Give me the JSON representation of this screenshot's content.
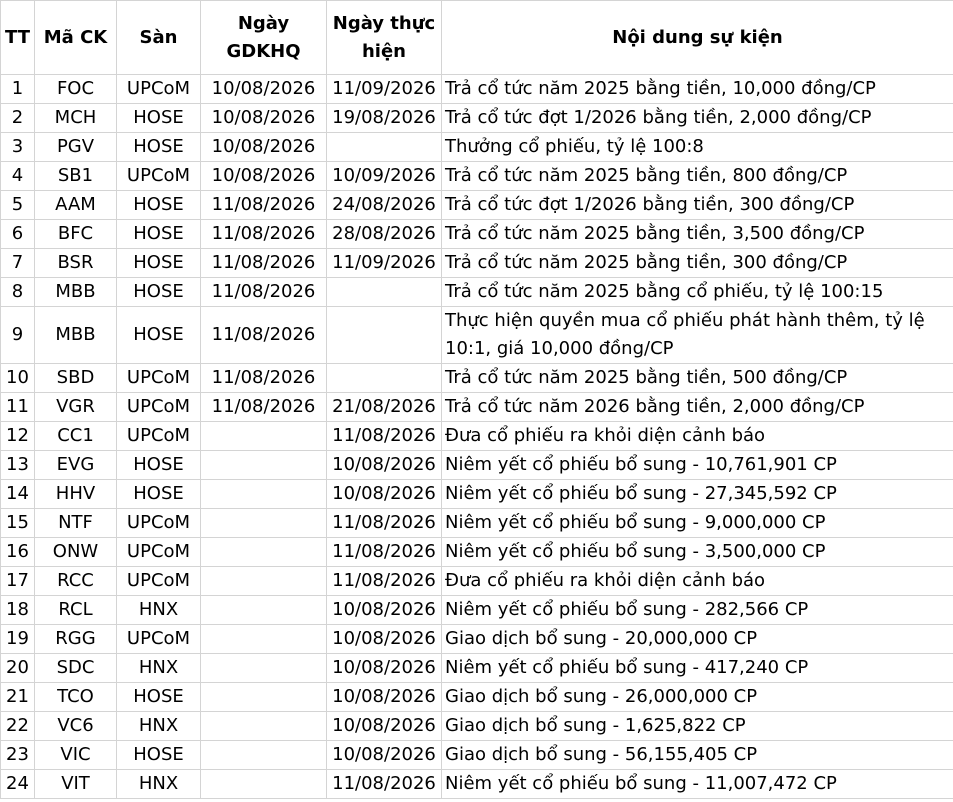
{
  "headers": {
    "tt": "TT",
    "ma_ck": "Mã CK",
    "san": "Sàn",
    "ngay_gdkhq": "Ngày GDKHQ",
    "ngay_thuc_hien": "Ngày thực hiện",
    "noi_dung": "Nội dung sự kiện"
  },
  "rows": [
    {
      "tt": "1",
      "ma": "FOC",
      "san": "UPCoM",
      "gdkhq": "10/08/2026",
      "thuchien": "11/09/2026",
      "noidung": "Trả cổ tức năm 2025 bằng tiền, 10,000 đồng/CP"
    },
    {
      "tt": "2",
      "ma": "MCH",
      "san": "HOSE",
      "gdkhq": "10/08/2026",
      "thuchien": "19/08/2026",
      "noidung": "Trả cổ tức đợt 1/2026 bằng tiền, 2,000 đồng/CP"
    },
    {
      "tt": "3",
      "ma": "PGV",
      "san": "HOSE",
      "gdkhq": "10/08/2026",
      "thuchien": "",
      "noidung": "Thưởng cổ phiếu, tỷ lệ 100:8"
    },
    {
      "tt": "4",
      "ma": "SB1",
      "san": "UPCoM",
      "gdkhq": "10/08/2026",
      "thuchien": "10/09/2026",
      "noidung": "Trả cổ tức năm 2025 bằng tiền, 800 đồng/CP"
    },
    {
      "tt": "5",
      "ma": "AAM",
      "san": "HOSE",
      "gdkhq": "11/08/2026",
      "thuchien": "24/08/2026",
      "noidung": "Trả cổ tức đợt 1/2026 bằng tiền, 300 đồng/CP"
    },
    {
      "tt": "6",
      "ma": "BFC",
      "san": "HOSE",
      "gdkhq": "11/08/2026",
      "thuchien": "28/08/2026",
      "noidung": "Trả cổ tức năm 2025 bằng tiền, 3,500 đồng/CP"
    },
    {
      "tt": "7",
      "ma": "BSR",
      "san": "HOSE",
      "gdkhq": "11/08/2026",
      "thuchien": "11/09/2026",
      "noidung": "Trả cổ tức năm 2025 bằng tiền, 300 đồng/CP"
    },
    {
      "tt": "8",
      "ma": "MBB",
      "san": "HOSE",
      "gdkhq": "11/08/2026",
      "thuchien": "",
      "noidung": "Trả cổ tức năm 2025 bằng cổ phiếu, tỷ lệ 100:15"
    },
    {
      "tt": "9",
      "ma": "MBB",
      "san": "HOSE",
      "gdkhq": "11/08/2026",
      "thuchien": "",
      "noidung": "Thực hiện quyền mua cổ phiếu phát hành thêm, tỷ lệ 10:1, giá 10,000 đồng/CP"
    },
    {
      "tt": "10",
      "ma": "SBD",
      "san": "UPCoM",
      "gdkhq": "11/08/2026",
      "thuchien": "",
      "noidung": "Trả cổ tức năm 2025 bằng tiền, 500 đồng/CP"
    },
    {
      "tt": "11",
      "ma": "VGR",
      "san": "UPCoM",
      "gdkhq": "11/08/2026",
      "thuchien": "21/08/2026",
      "noidung": "Trả cổ tức năm 2026 bằng tiền, 2,000 đồng/CP"
    },
    {
      "tt": "12",
      "ma": "CC1",
      "san": "UPCoM",
      "gdkhq": "",
      "thuchien": "11/08/2026",
      "noidung": "Đưa cổ phiếu ra khỏi diện cảnh báo"
    },
    {
      "tt": "13",
      "ma": "EVG",
      "san": "HOSE",
      "gdkhq": "",
      "thuchien": "10/08/2026",
      "noidung": "Niêm yết cổ phiếu bổ sung - 10,761,901 CP"
    },
    {
      "tt": "14",
      "ma": "HHV",
      "san": "HOSE",
      "gdkhq": "",
      "thuchien": "10/08/2026",
      "noidung": "Niêm yết cổ phiếu bổ sung - 27,345,592 CP"
    },
    {
      "tt": "15",
      "ma": "NTF",
      "san": "UPCoM",
      "gdkhq": "",
      "thuchien": "11/08/2026",
      "noidung": "Niêm yết cổ phiếu bổ sung - 9,000,000 CP"
    },
    {
      "tt": "16",
      "ma": "ONW",
      "san": "UPCoM",
      "gdkhq": "",
      "thuchien": "11/08/2026",
      "noidung": "Niêm yết cổ phiếu bổ sung - 3,500,000 CP"
    },
    {
      "tt": "17",
      "ma": "RCC",
      "san": "UPCoM",
      "gdkhq": "",
      "thuchien": "11/08/2026",
      "noidung": "Đưa cổ phiếu ra khỏi diện cảnh báo"
    },
    {
      "tt": "18",
      "ma": "RCL",
      "san": "HNX",
      "gdkhq": "",
      "thuchien": "10/08/2026",
      "noidung": "Niêm yết cổ phiếu bổ sung - 282,566 CP"
    },
    {
      "tt": "19",
      "ma": "RGG",
      "san": "UPCoM",
      "gdkhq": "",
      "thuchien": "10/08/2026",
      "noidung": "Giao dịch bổ sung - 20,000,000 CP"
    },
    {
      "tt": "20",
      "ma": "SDC",
      "san": "HNX",
      "gdkhq": "",
      "thuchien": "10/08/2026",
      "noidung": "Niêm yết cổ phiếu bổ sung - 417,240 CP"
    },
    {
      "tt": "21",
      "ma": "TCO",
      "san": "HOSE",
      "gdkhq": "",
      "thuchien": "10/08/2026",
      "noidung": "Giao dịch bổ sung - 26,000,000 CP"
    },
    {
      "tt": "22",
      "ma": "VC6",
      "san": "HNX",
      "gdkhq": "",
      "thuchien": "10/08/2026",
      "noidung": "Giao dịch bổ sung - 1,625,822 CP"
    },
    {
      "tt": "23",
      "ma": "VIC",
      "san": "HOSE",
      "gdkhq": "",
      "thuchien": "10/08/2026",
      "noidung": "Giao dịch bổ sung - 56,155,405 CP"
    },
    {
      "tt": "24",
      "ma": "VIT",
      "san": "HNX",
      "gdkhq": "",
      "thuchien": "11/08/2026",
      "noidung": "Niêm yết cổ phiếu bổ sung - 11,007,472 CP"
    }
  ]
}
